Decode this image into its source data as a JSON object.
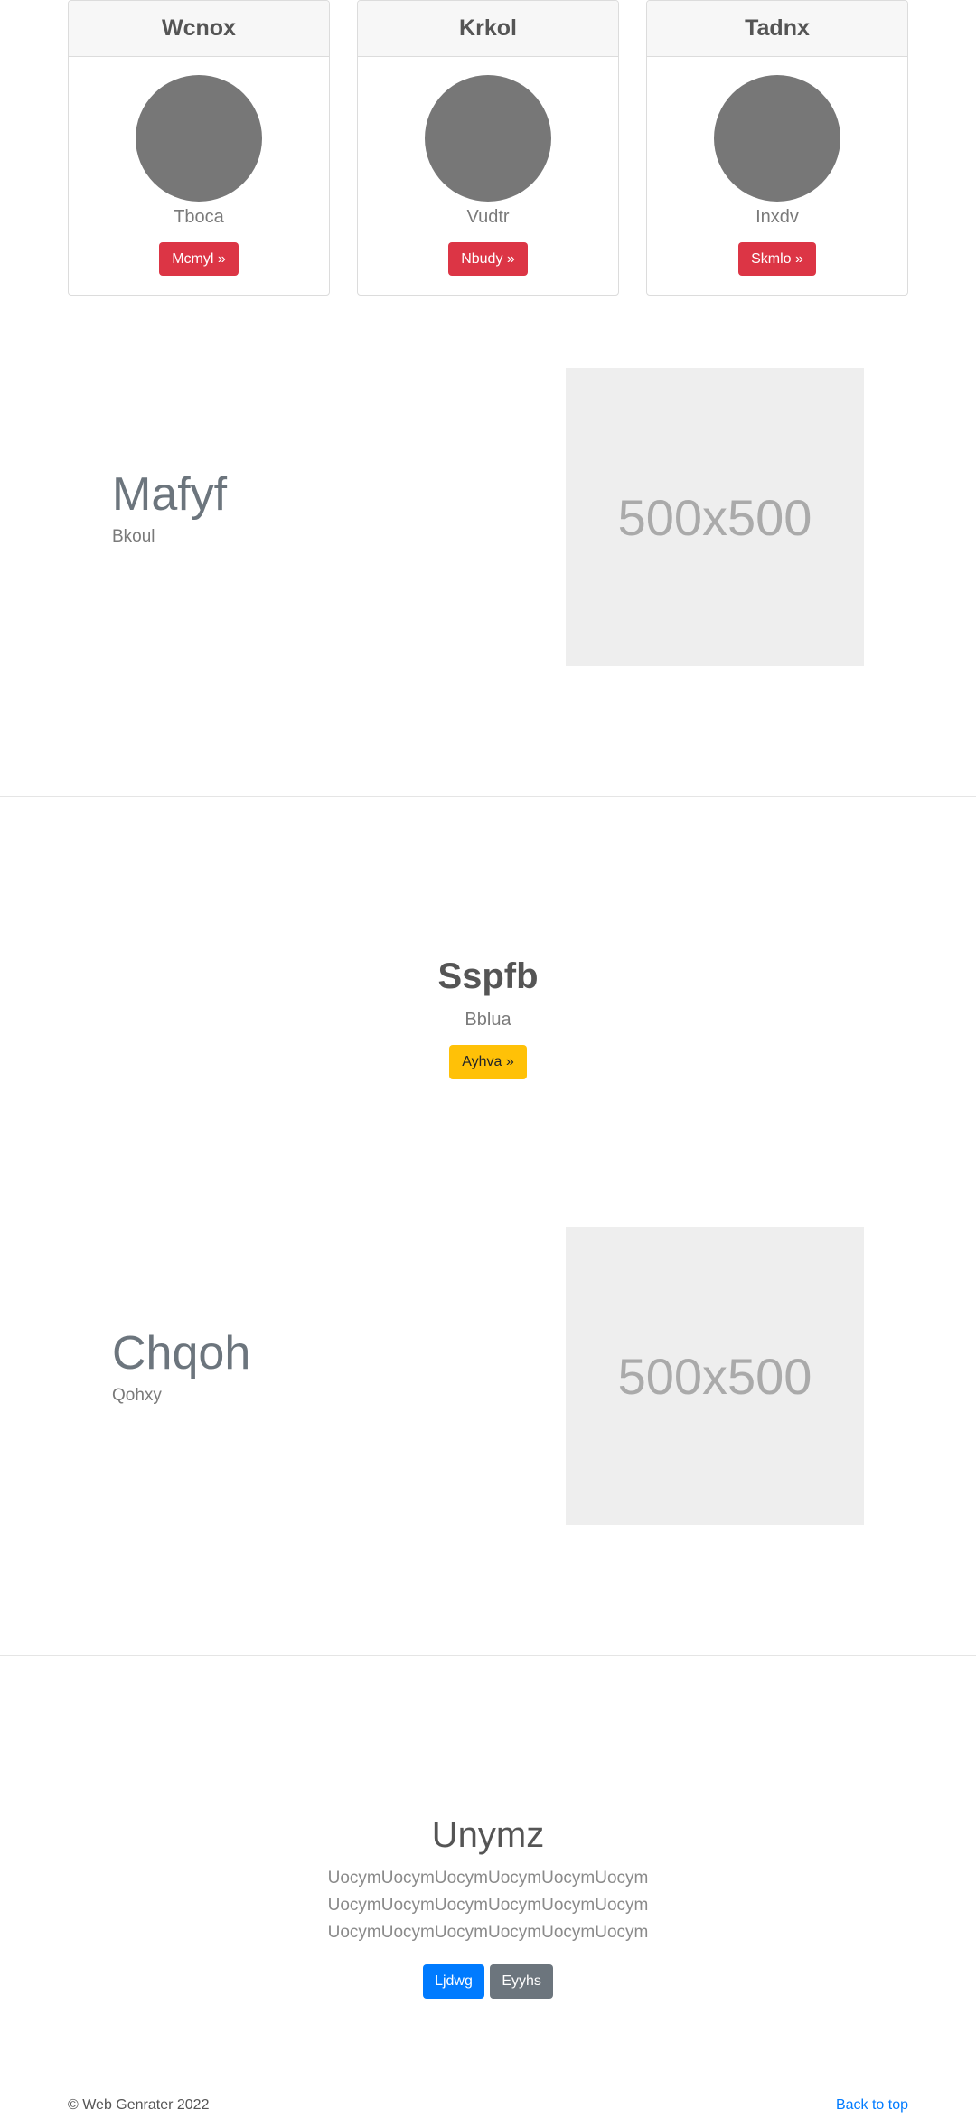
{
  "cards": [
    {
      "title": "Wcnox",
      "subtitle": "Tboca",
      "button": "Mcmyl »"
    },
    {
      "title": "Krkol",
      "subtitle": "Vudtr",
      "button": "Nbudy »"
    },
    {
      "title": "Tadnx",
      "subtitle": "Inxdv",
      "button": "Skmlo »"
    }
  ],
  "features": [
    {
      "heading": "Mafyf",
      "subheading": "Bkoul",
      "image_text": "500x500"
    },
    {
      "heading": "Chqoh",
      "subheading": "Qohxy",
      "image_text": "500x500"
    }
  ],
  "cta": {
    "title": "Sspfb",
    "subtitle": "Bblua",
    "button": "Ayhva »"
  },
  "jumbotron": {
    "title": "Unymz",
    "lines": [
      "UocymUocymUocymUocymUocymUocym",
      "UocymUocymUocymUocymUocymUocym",
      "UocymUocymUocymUocymUocymUocym"
    ],
    "primary_button": "Ljdwg",
    "secondary_button": "Eyyhs"
  },
  "footer": {
    "copyright": "© Web Genrater 2022",
    "back_to_top": "Back to top"
  },
  "colors": {
    "danger": "#dc3545",
    "warning": "#ffc107",
    "primary": "#007bff",
    "secondary": "#6c757d",
    "avatar": "#777777",
    "placeholder_bg": "#eeeeee"
  }
}
